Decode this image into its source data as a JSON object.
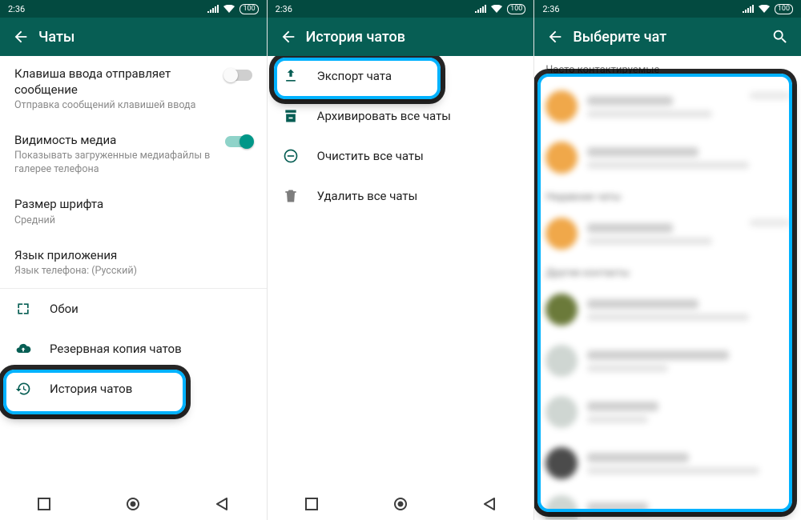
{
  "status": {
    "time": "2:36",
    "battery": "100"
  },
  "colors": {
    "accent": "#075e54",
    "switchOn": "#009788",
    "hlBlue": "#00b2ff"
  },
  "pane1": {
    "title": "Чаты",
    "enterSend": {
      "title": "Клавиша ввода отправляет сообщение",
      "sub": "Отправка сообщений клавишей ввода"
    },
    "mediaVis": {
      "title": "Видимость медиа",
      "sub": "Показывать загруженные медиафайлы в галерее телефона"
    },
    "fontSize": {
      "title": "Размер шрифта",
      "sub": "Средний"
    },
    "appLang": {
      "title": "Язык приложения",
      "sub": "Язык телефона: (Русский)"
    },
    "wallpaper": "Обои",
    "backup": "Резервная копия чатов",
    "history": "История чатов"
  },
  "pane2": {
    "title": "История чатов",
    "export": "Экспорт чата",
    "archive": "Архивировать все чаты",
    "clear": "Очистить все чаты",
    "delete": "Удалить все чаты"
  },
  "pane3": {
    "title": "Выберите чат",
    "freq": "Часто контактируемые",
    "recent": "Недавние чаты",
    "other": "Другие контакты"
  }
}
